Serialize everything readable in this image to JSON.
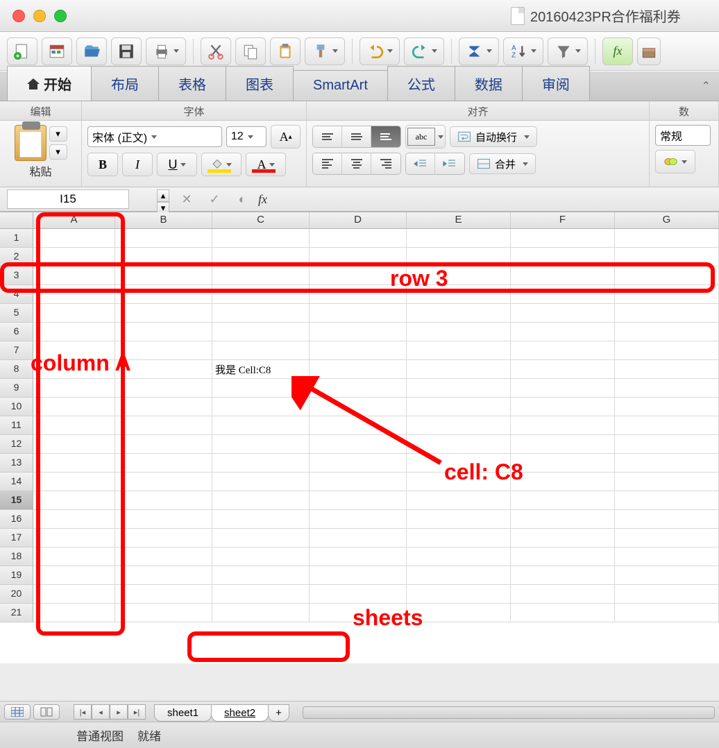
{
  "window": {
    "title": "20160423PR合作福利券"
  },
  "ribbon_tabs": {
    "home": "开始",
    "layout": "布局",
    "tables": "表格",
    "charts": "图表",
    "smartart": "SmartArt",
    "formulas": "公式",
    "data": "数据",
    "review": "审阅"
  },
  "groups": {
    "edit": "编辑",
    "font": "字体",
    "align": "对齐",
    "number": "数"
  },
  "clipboard": {
    "paste": "粘贴"
  },
  "font": {
    "name": "宋体 (正文)",
    "size": "12",
    "bold": "B",
    "italic": "I",
    "underline": "U"
  },
  "align": {
    "abc": "abc",
    "wrap": "自动换行",
    "merge": "合并"
  },
  "number": {
    "format": "常规"
  },
  "formula_bar": {
    "namebox": "I15",
    "fx": "fx"
  },
  "columns": [
    "A",
    "B",
    "C",
    "D",
    "E",
    "F",
    "G"
  ],
  "rows": [
    "1",
    "2",
    "3",
    "4",
    "5",
    "6",
    "7",
    "8",
    "9",
    "10",
    "11",
    "12",
    "13",
    "14",
    "15",
    "16",
    "17",
    "18",
    "19",
    "20",
    "21"
  ],
  "selected_row_index": 14,
  "cells": {
    "C8": "我是 Cell:C8"
  },
  "sheets": {
    "s1": "sheet1",
    "s2": "sheet2"
  },
  "status": {
    "view": "普通视图",
    "ready": "就绪"
  },
  "annotations": {
    "colA": "column A",
    "row3": "row 3",
    "cellC8": "cell: C8",
    "sheets": "sheets"
  }
}
